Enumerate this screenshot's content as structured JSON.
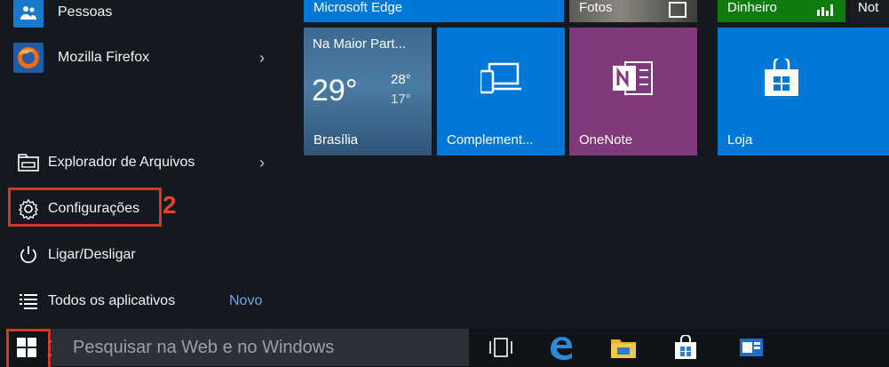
{
  "left_menu": {
    "pessoas": "Pessoas",
    "firefox": "Mozilla Firefox",
    "explorador": "Explorador de Arquivos",
    "configuracoes": "Configurações",
    "ligar": "Ligar/Desligar",
    "todos": "Todos os aplicativos",
    "novo_badge": "Novo",
    "chevron": "›"
  },
  "annotations": {
    "step1": "1",
    "step2": "2"
  },
  "tiles": {
    "edge": "Microsoft Edge",
    "fotos": "Fotos",
    "dinheiro": "Dinheiro",
    "not": "Not",
    "weather_title": "Na Maior Part...",
    "weather_temp": "29°",
    "weather_high": "28°",
    "weather_low": "17°",
    "weather_city": "Brasília",
    "complement": "Complement...",
    "onenote": "OneNote",
    "loja": "Loja"
  },
  "search": {
    "placeholder": "Pesquisar na Web e no Windows"
  },
  "colors": {
    "tile_blue": "#0078d7",
    "onenote_purple": "#80397b",
    "dinheiro_green": "#107c10",
    "annotation_red": "#d03a25",
    "novo_blue": "#6aa6f0"
  },
  "icons": [
    "people-icon",
    "firefox-icon",
    "folder-icon",
    "gear-icon",
    "power-icon",
    "list-icon",
    "windows-icon",
    "task-view-icon",
    "edge-icon",
    "file-explorer-icon",
    "store-icon",
    "app-icon"
  ]
}
